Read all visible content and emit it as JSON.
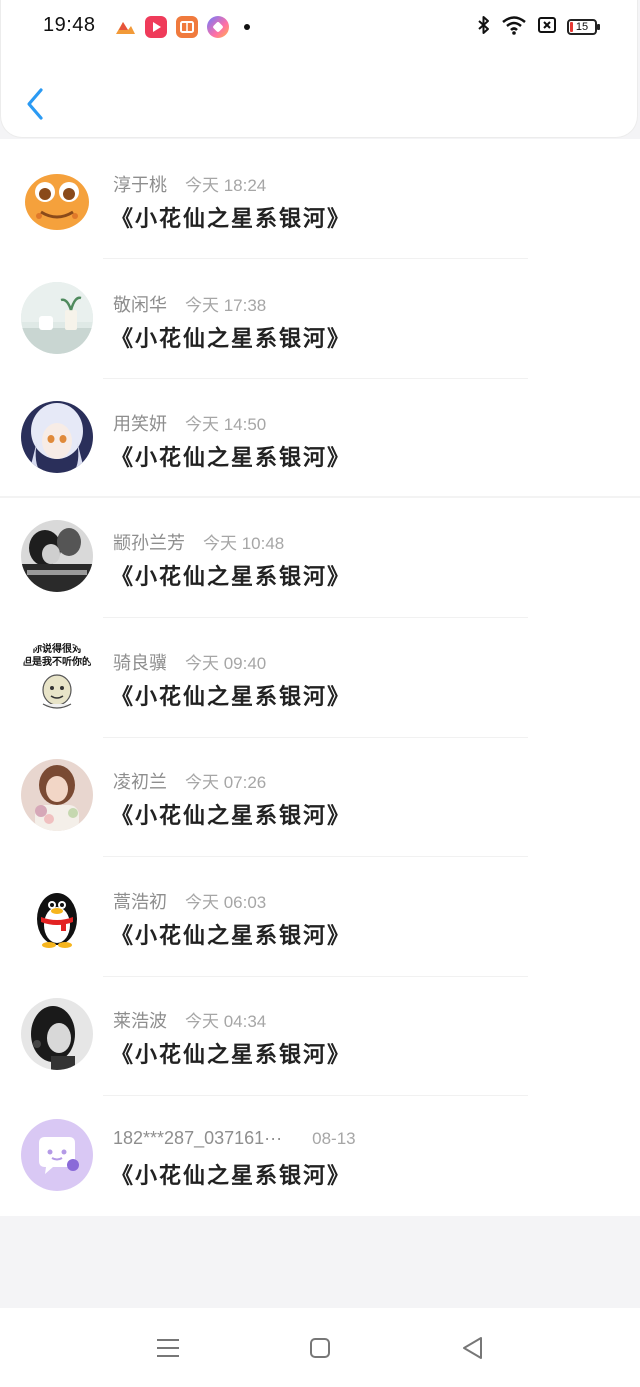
{
  "status_bar": {
    "time": "19:48",
    "battery_level": "15",
    "icons": [
      "gallery-app-icon",
      "video-app-icon",
      "reader-app-icon",
      "browser-app-icon",
      "bluetooth-icon",
      "wifi-icon",
      "sim-icon",
      "battery-icon"
    ]
  },
  "header": {
    "back_icon": "back-chevron-icon"
  },
  "messages": [
    {
      "name": "淳于桃",
      "time": "今天 18:24",
      "text": "《小花仙之星系银河》",
      "avatar": "orange-cartoon-avatar"
    },
    {
      "name": "敬闲华",
      "time": "今天 17:38",
      "text": "《小花仙之星系银河》",
      "avatar": "plant-cup-avatar"
    },
    {
      "name": "用笑妍",
      "time": "今天 14:50",
      "text": "《小花仙之星系银河》",
      "avatar": "anime-girl-avatar"
    },
    {
      "name": "颛孙兰芳",
      "time": "今天 10:48",
      "text": "《小花仙之星系银河》",
      "avatar": "bw-couple-avatar"
    },
    {
      "name": "骑良骥",
      "time": "今天 09:40",
      "text": "《小花仙之星系银河》",
      "avatar": "meme-avatar",
      "avatar_text": [
        "你说得很对",
        "但是我不听你的"
      ]
    },
    {
      "name": "凌初兰",
      "time": "今天 07:26",
      "text": "《小花仙之星系银河》",
      "avatar": "girl-flowers-avatar"
    },
    {
      "name": "蒿浩初",
      "time": "今天 06:03",
      "text": "《小花仙之星系银河》",
      "avatar": "penguin-avatar"
    },
    {
      "name": "莱浩波",
      "time": "今天 04:34",
      "text": "《小花仙之星系银河》",
      "avatar": "bw-girl-avatar"
    },
    {
      "name": "182***287_037161···",
      "time": "08-13",
      "text": "《小花仙之星系银河》",
      "avatar": "chat-bubble-avatar"
    }
  ],
  "nav_bar": {
    "icons": [
      "menu-icon",
      "home-square-icon",
      "back-triangle-icon"
    ]
  },
  "colors": {
    "accent": "#2b9af3",
    "name_gray": "#8e8e8e",
    "time_gray": "#a6a6a6",
    "message_text": "#222222",
    "background": "#f4f4f6"
  }
}
